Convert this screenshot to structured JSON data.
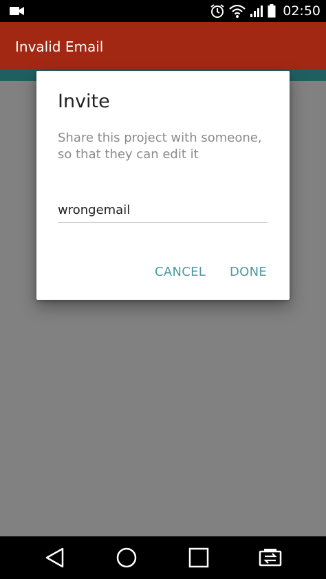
{
  "status_bar": {
    "time": "02:50",
    "icons": [
      "video-camera-icon",
      "alarm-clock-icon",
      "wifi-icon",
      "cellular-signal-icon",
      "battery-icon"
    ]
  },
  "app_bar": {
    "title": "Invalid Email",
    "color": "#a32814"
  },
  "dialog": {
    "title": "Invite",
    "message": "Share this project with someone, so that they can edit it",
    "email_value": "wrongemail",
    "cancel_label": "CANCEL",
    "done_label": "DONE",
    "accent_color": "#4a9aa0"
  },
  "nav_bar": {
    "icons": [
      "back-icon",
      "home-icon",
      "recents-icon",
      "screen-switch-icon"
    ]
  }
}
